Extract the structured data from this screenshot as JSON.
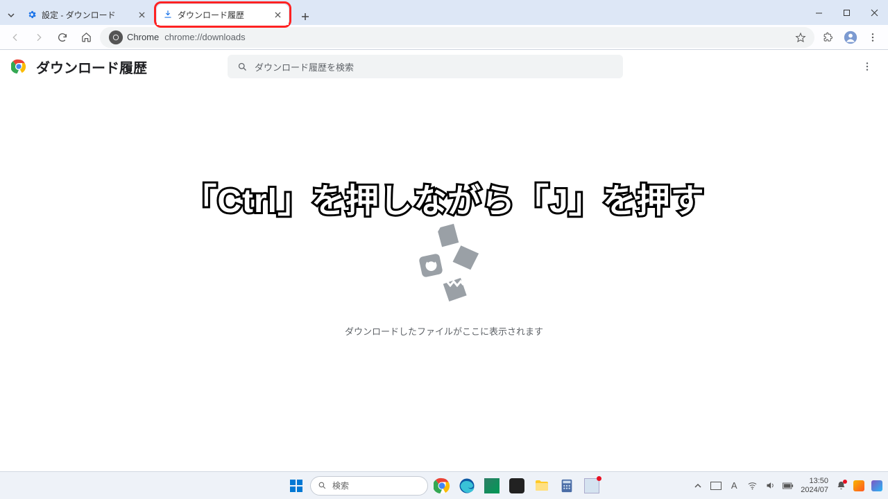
{
  "tabstrip": {
    "tabs": [
      {
        "title": "設定 - ダウンロード",
        "icon": "gear"
      },
      {
        "title": "ダウンロード履歴",
        "icon": "download"
      }
    ]
  },
  "toolbar": {
    "site_chip": "Chrome",
    "url": "chrome://downloads"
  },
  "page": {
    "title": "ダウンロード履歴",
    "search_placeholder": "ダウンロード履歴を検索",
    "empty_message": "ダウンロードしたファイルがここに表示されます"
  },
  "overlay": {
    "text": "「Ctrl」を押しながら「J」を押す"
  },
  "taskbar": {
    "search_placeholder": "検索",
    "clock_time": "13:50",
    "clock_date": "2024/07"
  }
}
